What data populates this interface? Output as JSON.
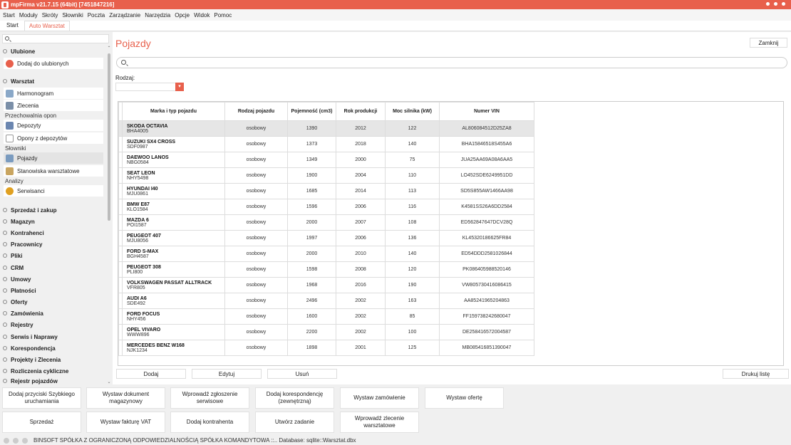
{
  "window": {
    "title": "mpFirma v21.7.15 (64bit) [7451847216]"
  },
  "menu": [
    "Start",
    "Moduły",
    "Skróty",
    "Słowniki",
    "Poczta",
    "Zarządzanie",
    "Narzędzia",
    "Opcje",
    "Widok",
    "Pomoc"
  ],
  "tabs": [
    {
      "label": "Start",
      "active": false
    },
    {
      "label": "Auto Warsztat",
      "active": true
    }
  ],
  "sidebar": {
    "sections": {
      "ulubione": "Ulubione",
      "warsztat": "Warsztat"
    },
    "fav_item": "Dodaj do ulubionych",
    "warsztat_items": [
      "Harmonogram",
      "Zlecenia"
    ],
    "group_przechowalnia": "Przechowalnia opon",
    "przechowalnia_items": [
      "Depozyty",
      "Opony z depozytów"
    ],
    "group_slowniki": "Słowniki",
    "slowniki_items": [
      "Pojazdy",
      "Stanowiska warsztatowe"
    ],
    "group_analizy": "Analizy",
    "analizy_items": [
      "Serwisanci"
    ],
    "collapsed_sections": [
      "Sprzedaż i zakup",
      "Magazyn",
      "Kontrahenci",
      "Pracownicy",
      "Pliki",
      "CRM",
      "Umowy",
      "Płatności",
      "Oferty",
      "Zamówienia",
      "Rejestry",
      "Serwis i Naprawy",
      "Korespondencja",
      "Projekty i Zlecenia",
      "Rozliczenia cykliczne",
      "Rejestr pojazdów"
    ]
  },
  "main": {
    "title": "Pojazdy",
    "close_label": "Zamknij",
    "search_placeholder": "",
    "rodzaj_label": "Rodzaj:",
    "rodzaj_value": ""
  },
  "table": {
    "columns": [
      "Marka i typ pojazdu",
      "Rodzaj pojazdu",
      "Pojemność (cm3)",
      "Rok produkcji",
      "Moc silnika (kW)",
      "Numer VIN"
    ],
    "rows": [
      {
        "name": "SKODA OCTAVIA",
        "plate": "BHA4005",
        "type": "osobowy",
        "capacity": "1390",
        "year": "2012",
        "power": "122",
        "vin": "AL806084512D25ZA8",
        "selected": true
      },
      {
        "name": "SUZUKI SX4 CROSS",
        "plate": "SDF0987",
        "type": "osobowy",
        "capacity": "1373",
        "year": "2018",
        "power": "140",
        "vin": "BHA15846518S455A6",
        "selected": false
      },
      {
        "name": "DAEWOO LANOS",
        "plate": "NBG0584",
        "type": "osobowy",
        "capacity": "1349",
        "year": "2000",
        "power": "75",
        "vin": "JUA25AA69A08A6AA5",
        "selected": false
      },
      {
        "name": "SEAT LEON",
        "plate": "NHY5498",
        "type": "osobowy",
        "capacity": "1900",
        "year": "2004",
        "power": "110",
        "vin": "LO452SDE6249951DD",
        "selected": false
      },
      {
        "name": "HYUNDAI I40",
        "plate": "MJU0861",
        "type": "osobowy",
        "capacity": "1685",
        "year": "2014",
        "power": "113",
        "vin": "SD5S855AW1466AA98",
        "selected": false
      },
      {
        "name": "BMW E87",
        "plate": "KLO1584",
        "type": "osobowy",
        "capacity": "1596",
        "year": "2006",
        "power": "116",
        "vin": "K4581SS26A6DD2584",
        "selected": false
      },
      {
        "name": "MAZDA 6",
        "plate": "POI1587",
        "type": "osobowy",
        "capacity": "2000",
        "year": "2007",
        "power": "108",
        "vin": "ED562847647DCV28Q",
        "selected": false
      },
      {
        "name": "PEUGEOT 407",
        "plate": "MJU8056",
        "type": "osobowy",
        "capacity": "1997",
        "year": "2006",
        "power": "136",
        "vin": "KL45320186625FR84",
        "selected": false
      },
      {
        "name": "FORD S-MAX",
        "plate": "BGH4587",
        "type": "osobowy",
        "capacity": "2000",
        "year": "2010",
        "power": "140",
        "vin": "ED54DDD2581026844",
        "selected": false
      },
      {
        "name": "PEUGEOT 308",
        "plate": "PLI800",
        "type": "osobowy",
        "capacity": "1598",
        "year": "2008",
        "power": "120",
        "vin": "PK086405988520146",
        "selected": false
      },
      {
        "name": "VOLKSWAGEN PASSAT ALLTRACK",
        "plate": "VFR805",
        "type": "osobowy",
        "capacity": "1968",
        "year": "2016",
        "power": "190",
        "vin": "VW805730416086415",
        "selected": false
      },
      {
        "name": "AUDI A6",
        "plate": "SDE492",
        "type": "osobowy",
        "capacity": "2496",
        "year": "2002",
        "power": "163",
        "vin": "AA85241965204863",
        "selected": false
      },
      {
        "name": "FORD FOCUS",
        "plate": "NHY456",
        "type": "osobowy",
        "capacity": "1600",
        "year": "2002",
        "power": "85",
        "vin": "FF159738242680047",
        "selected": false
      },
      {
        "name": "OPEL VIVARO",
        "plate": "WWW896",
        "type": "osobowy",
        "capacity": "2200",
        "year": "2002",
        "power": "100",
        "vin": "DE258416572004587",
        "selected": false
      },
      {
        "name": "MERCEDES BENZ W168",
        "plate": "NJK1234",
        "type": "osobowy",
        "capacity": "1898",
        "year": "2001",
        "power": "125",
        "vin": "MB085416851390047",
        "selected": false
      }
    ]
  },
  "bottom_buttons": {
    "add": "Dodaj",
    "edit": "Edytuj",
    "delete": "Usuń",
    "print": "Drukuj listę"
  },
  "quick_actions": {
    "row1": [
      "Dodaj przyciski Szybkiego uruchamiania",
      "Wystaw dokument magazynowy",
      "Wprowadź zgłoszenie serwisowe",
      "Dodaj korespondencję (zewnętrzną)",
      "Wystaw zamówienie",
      "Wystaw ofertę"
    ],
    "row2": [
      "Sprzedaż",
      "Wystaw fakturę VAT",
      "Dodaj kontrahenta",
      "Utwórz zadanie",
      "Wprowadź zlecenie warsztatowe"
    ]
  },
  "status": {
    "text": "BINSOFT SPÓŁKA Z OGRANICZONĄ ODPOWIEDZIALNOŚCIĄ SPÓŁKA KOMANDYTOWA ::.. Database: sqlite::Warsztat.dbx"
  },
  "colors": {
    "accent": "#e8604c"
  }
}
